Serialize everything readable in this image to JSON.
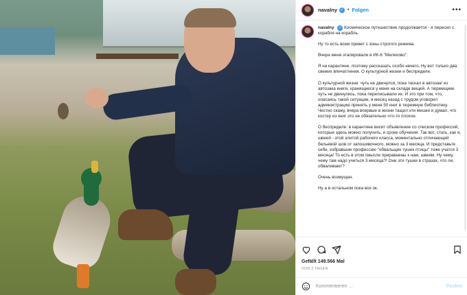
{
  "post": {
    "username": "navalny",
    "follow_label": "Folgen",
    "caption_paragraphs": [
      "Космическое путешествие продолжается - я пересел с корабля на корабль.",
      "Ну то есть всем привет с зоны строгого режима.",
      "Вчера меня этапировали в ИК-6 \"Мелехово\".",
      "Я на карантине, поэтому рассказать особо нечего. Ну вот только два свежих впечатления. О культурной жизни и беспределе.",
      "О культурной жизни: чуть не двинулся, пока таскал в автозак/ из автозака книги, хранящиеся у меня на складе вещей. А тюремщики чуть не двинулись, пока переписывали их. И это при том, что, опасаясь такой ситуации, я месяц назад с трудом уговорил администрацию принять у меня 50 книг в тюремную библиотеку. Честно скажу, вчера впервые в жизни тащил эти мешки и думал, что костер из книг это не обязательно что-то плохое.",
      "О беспределе: в карантине висит объявление со списком профессий, которые здесь можно получить, и сроке обучения. Так вот, стать, как я, швеей - этой элитой рабочего класса, моментально отличающей бельевой шов от запошивочного, можно за 3 месяца. И представьте себе, избравшие профессию \"обвальщик тушек птицы\" тоже учатся 3 месяца! То есть в этом смысле приравнены к нам, швеям. Ну чему, чему там надо учиться 3 месяца?! Они эти тушки в стразах, что ли, обваливают?",
      "Очень возмущен.",
      "Ну а в остальном пока все ок."
    ],
    "likes": "Gefällt 149.566 Mal",
    "date": "VOR 2 TAGEN",
    "comment_placeholder": "Kommentieren ...",
    "post_button": "Posten"
  },
  "icons": {
    "more": "more-options-icon",
    "like": "heart-icon",
    "comment": "comment-icon",
    "share": "share-icon",
    "save": "bookmark-icon",
    "emoji": "emoji-icon",
    "verified": "verified-badge-icon"
  },
  "colors": {
    "accent": "#0095f6",
    "verified": "#3897f0",
    "text": "#262626",
    "muted": "#8e8e8e"
  }
}
